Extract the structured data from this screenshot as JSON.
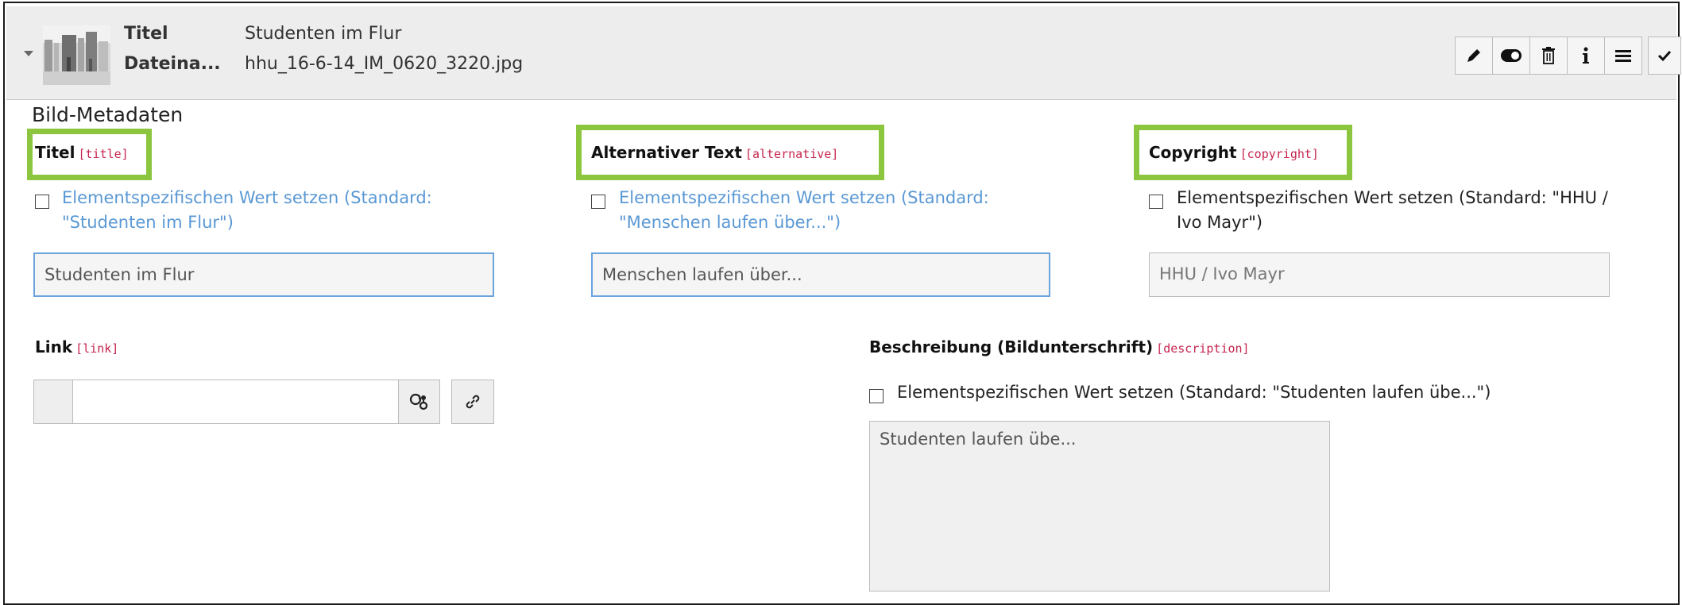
{
  "header": {
    "thumbnail_alt": "Bildvorschau",
    "title_label": "Titel",
    "title_value": "Studenten im Flur",
    "filename_label": "Dateina...",
    "filename_value": "hhu_16-6-14_IM_0620_3220.jpg",
    "toolbar_icons": [
      "pencil-icon",
      "toggle-icon",
      "trash-icon",
      "info-icon",
      "menu-icon",
      "checkmark-icon"
    ]
  },
  "section": {
    "title": "Bild-Metadaten"
  },
  "fields": {
    "title": {
      "label": "Titel",
      "code": "[title]",
      "override_text": "Elementspezifischen Wert setzen (Standard: \"Studenten im Flur\")",
      "override_line1": "Elementspezifischen Wert setzen (Standard:",
      "override_line2": "\"Studenten im Flur\")",
      "value": "Studenten im Flur"
    },
    "alternative": {
      "label": "Alternativer Text",
      "code": "[alternative]",
      "override_line1": "Elementspezifischen Wert setzen (Standard:",
      "override_line2": "\"Menschen laufen über...\")",
      "value": "Menschen laufen über..."
    },
    "copyright": {
      "label": "Copyright",
      "code": "[copyright]",
      "override_line1": "Elementspezifischen Wert setzen (Standard: \"HHU /",
      "override_line2": "Ivo Mayr\")",
      "value": "HHU / Ivo Mayr"
    },
    "link": {
      "label": "Link",
      "code": "[link]",
      "value": ""
    },
    "description": {
      "label": "Beschreibung (Bildunterschrift)",
      "code": "[description]",
      "override_text": "Elementspezifischen Wert setzen (Standard: \"Studenten laufen übe...\")",
      "value": "Studenten laufen übe..."
    }
  },
  "colors": {
    "highlight": "#8cc63f",
    "code": "#c7254e",
    "link_text": "#5a98d4",
    "header_bg": "#ededed"
  }
}
